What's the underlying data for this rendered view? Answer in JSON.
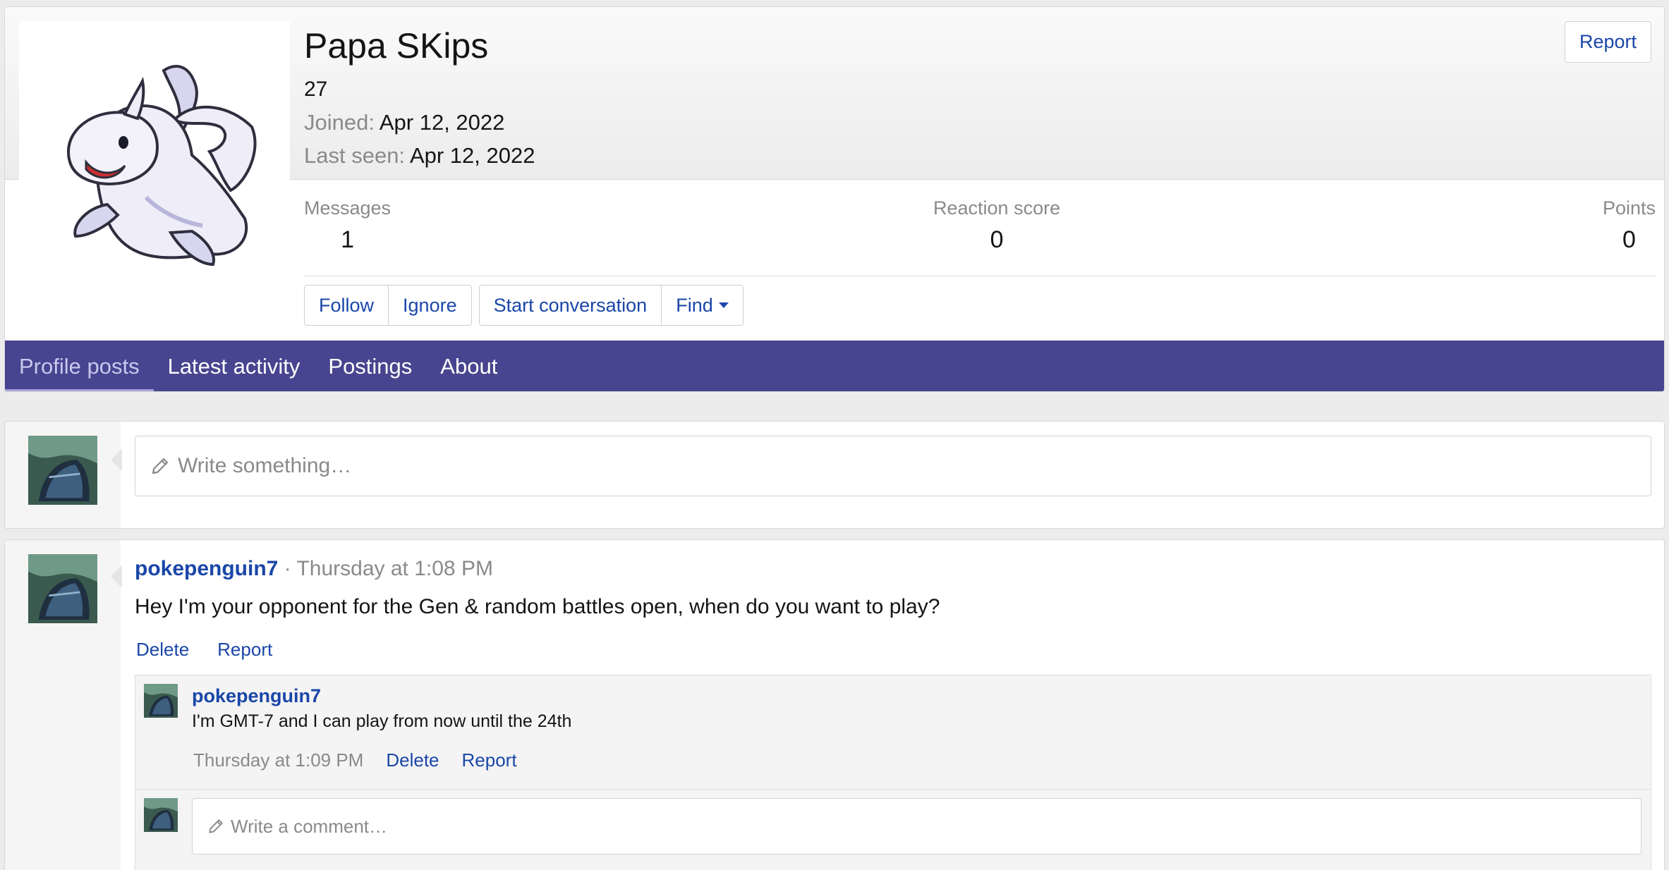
{
  "profile": {
    "name": "Papa SKips",
    "age": "27",
    "joined_label": "Joined:",
    "joined_value": "Apr 12, 2022",
    "last_seen_label": "Last seen:",
    "last_seen_value": "Apr 12, 2022",
    "report_label": "Report",
    "avatar_icon": "seal-pokemon-avatar"
  },
  "stats": {
    "messages_label": "Messages",
    "messages_value": "1",
    "reaction_label": "Reaction score",
    "reaction_value": "0",
    "points_label": "Points",
    "points_value": "0"
  },
  "actions": {
    "follow": "Follow",
    "ignore": "Ignore",
    "start_conversation": "Start conversation",
    "find": "Find"
  },
  "tabs": [
    {
      "label": "Profile posts",
      "active": true
    },
    {
      "label": "Latest activity",
      "active": false
    },
    {
      "label": "Postings",
      "active": false
    },
    {
      "label": "About",
      "active": false
    }
  ],
  "compose": {
    "placeholder": "Write something…"
  },
  "post": {
    "user": "pokepenguin7",
    "separator": " · ",
    "time": "Thursday at 1:08 PM",
    "body": "Hey I'm your opponent for the Gen & random battles open, when do you want to play?",
    "delete_label": "Delete",
    "report_label": "Report",
    "comment": {
      "user": "pokepenguin7",
      "text": "I'm GMT-7 and I can play from now until the 24th",
      "time": "Thursday at 1:09 PM",
      "delete_label": "Delete",
      "report_label": "Report"
    },
    "reply_placeholder": "Write a comment…"
  },
  "colors": {
    "tab_bar": "#47458f",
    "link": "#1a46a8",
    "muted": "#8a8a8a"
  }
}
